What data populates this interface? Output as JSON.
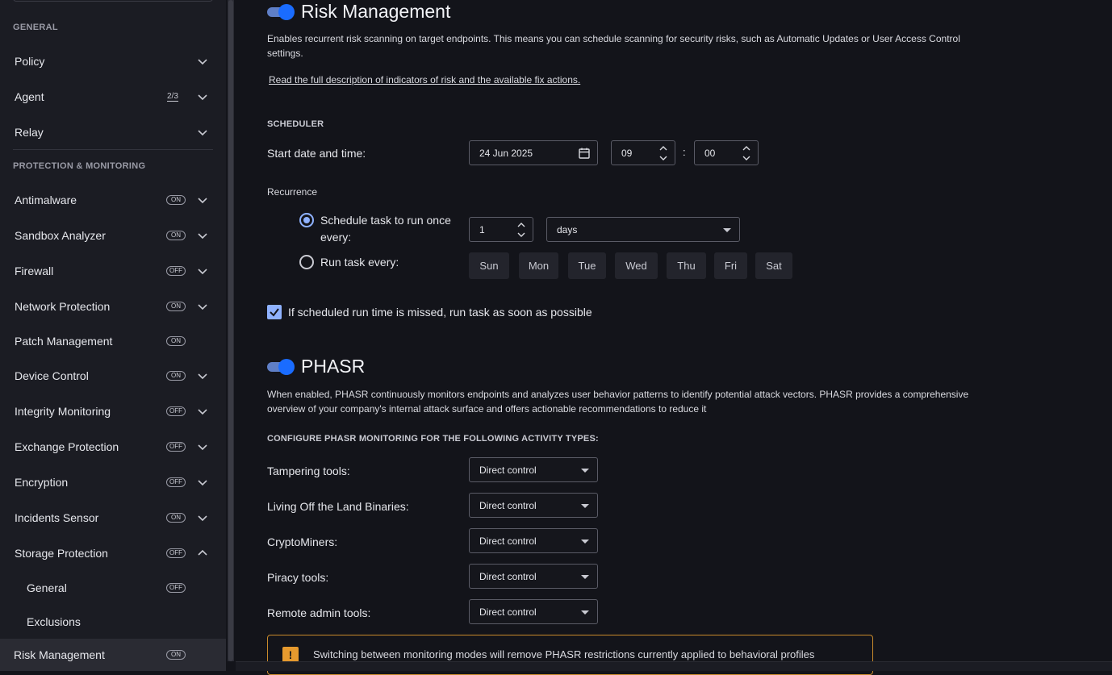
{
  "sidebar": {
    "general_heading": "GENERAL",
    "protection_heading": "PROTECTION & MONITORING",
    "general_items": [
      {
        "label": "Policy"
      },
      {
        "label": "Agent",
        "count": "2/3"
      },
      {
        "label": "Relay"
      }
    ],
    "items": [
      {
        "label": "Antimalware",
        "status": "ON"
      },
      {
        "label": "Sandbox Analyzer",
        "status": "ON"
      },
      {
        "label": "Firewall",
        "status": "OFF"
      },
      {
        "label": "Network Protection",
        "status": "ON"
      },
      {
        "label": "Patch Management",
        "status": "ON"
      },
      {
        "label": "Device Control",
        "status": "ON"
      },
      {
        "label": "Integrity Monitoring",
        "status": "OFF"
      },
      {
        "label": "Exchange Protection",
        "status": "OFF"
      },
      {
        "label": "Encryption",
        "status": "OFF"
      },
      {
        "label": "Incidents Sensor",
        "status": "ON"
      },
      {
        "label": "Storage Protection",
        "status": "OFF"
      },
      {
        "label": "General",
        "status": "OFF"
      },
      {
        "label": "Exclusions"
      },
      {
        "label": "Risk Management",
        "status": "ON"
      }
    ]
  },
  "risk": {
    "title": "Risk Management",
    "description_line1": "Enables recurrent risk scanning on target endpoints. This means you can schedule scanning for security risks, such as Automatic Updates or User Access Control",
    "description_line2": "settings.",
    "link": "Read the full description of indicators of risk and the available fix actions.",
    "scheduler_heading": "SCHEDULER",
    "start_label": "Start date and time:",
    "date_value": "24 Jun 2025",
    "hour_value": "09",
    "time_separator": ":",
    "minute_value": "00",
    "recurrence_label": "Recurrence",
    "option_once_line1": "Schedule task to run once",
    "option_once_line2": "every:",
    "interval_value": "1",
    "unit_value": "days",
    "option_every": "Run task every:",
    "days": [
      "Sun",
      "Mon",
      "Tue",
      "Wed",
      "Thu",
      "Fri",
      "Sat"
    ],
    "missed_label": "If scheduled run time is missed, run task as soon as possible"
  },
  "phasr": {
    "title": "PHASR",
    "description_line1": "When enabled, PHASR continuously monitors endpoints and analyzes user behavior patterns to identify potential attack vectors. PHASR provides a comprehensive",
    "description_line2": "overview of your company's internal attack surface and offers actionable recommendations to reduce it",
    "configure_heading": "CONFIGURE PHASR MONITORING FOR THE FOLLOWING ACTIVITY TYPES:",
    "activities": [
      {
        "label": "Tampering tools:",
        "value": "Direct control"
      },
      {
        "label": "Living Off the Land Binaries:",
        "value": "Direct control"
      },
      {
        "label": "CryptoMiners:",
        "value": "Direct control"
      },
      {
        "label": "Piracy tools:",
        "value": "Direct control"
      },
      {
        "label": "Remote admin tools:",
        "value": "Direct control"
      }
    ],
    "warning": "Switching between monitoring modes will remove PHASR restrictions currently applied to behavioral profiles"
  },
  "colors": {
    "accent": "#1a6cff",
    "checkbox": "#8fb2ff",
    "warning": "#e69a2e"
  }
}
